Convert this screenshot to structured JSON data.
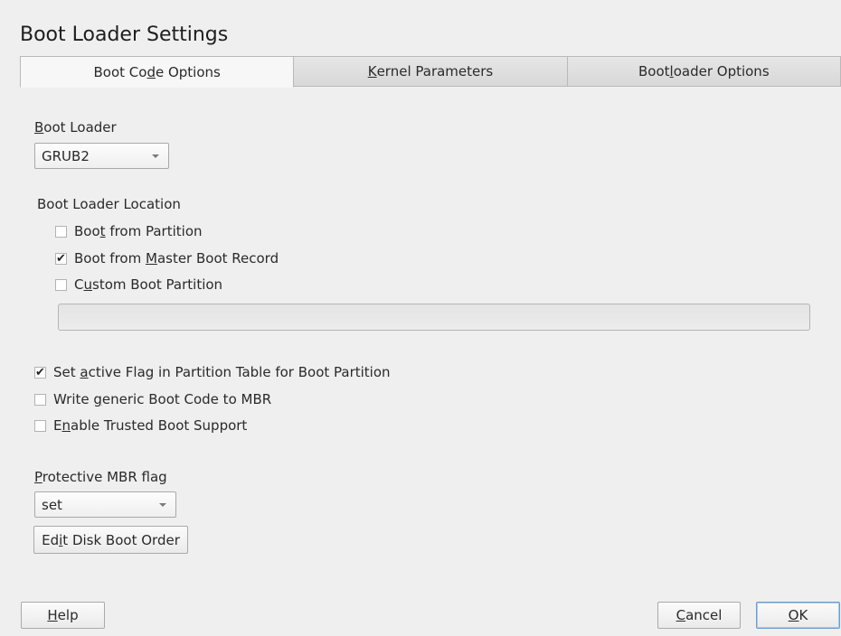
{
  "window": {
    "title": "Boot Loader Settings"
  },
  "tabs": [
    {
      "pre": "Boot Co",
      "key": "d",
      "post": "e Options"
    },
    {
      "pre": "",
      "key": "K",
      "post": "ernel Parameters"
    },
    {
      "pre": "Boot",
      "key": "l",
      "post": "oader Options"
    }
  ],
  "boot_loader": {
    "label": {
      "pre": "",
      "key": "B",
      "post": "oot Loader"
    },
    "value": "GRUB2"
  },
  "location": {
    "label": "Boot Loader Location",
    "options": [
      {
        "pre": "Boo",
        "key": "t",
        "post": " from Partition",
        "checked": false
      },
      {
        "pre": "Boot from ",
        "key": "M",
        "post": "aster Boot Record",
        "checked": true
      },
      {
        "pre": "C",
        "key": "u",
        "post": "stom Boot Partition",
        "checked": false
      }
    ],
    "custom_partition_value": ""
  },
  "options": [
    {
      "pre": "Set ",
      "key": "a",
      "post": "ctive Flag in Partition Table for Boot Partition",
      "checked": true
    },
    {
      "pre": "Write ",
      "key": "g",
      "post": "eneric Boot Code to MBR",
      "checked": false
    },
    {
      "pre": "E",
      "key": "n",
      "post": "able Trusted Boot Support",
      "checked": false
    }
  ],
  "protective_mbr": {
    "label": {
      "pre": "",
      "key": "P",
      "post": "rotective MBR flag"
    },
    "value": "set"
  },
  "edit_order_button": {
    "pre": "Ed",
    "key": "i",
    "post": "t Disk Boot Order"
  },
  "footer": {
    "help": {
      "pre": "",
      "key": "H",
      "post": "elp"
    },
    "cancel": {
      "pre": "",
      "key": "C",
      "post": "ancel"
    },
    "ok": {
      "pre": "",
      "key": "O",
      "post": "K"
    }
  },
  "check_mark": "✔"
}
